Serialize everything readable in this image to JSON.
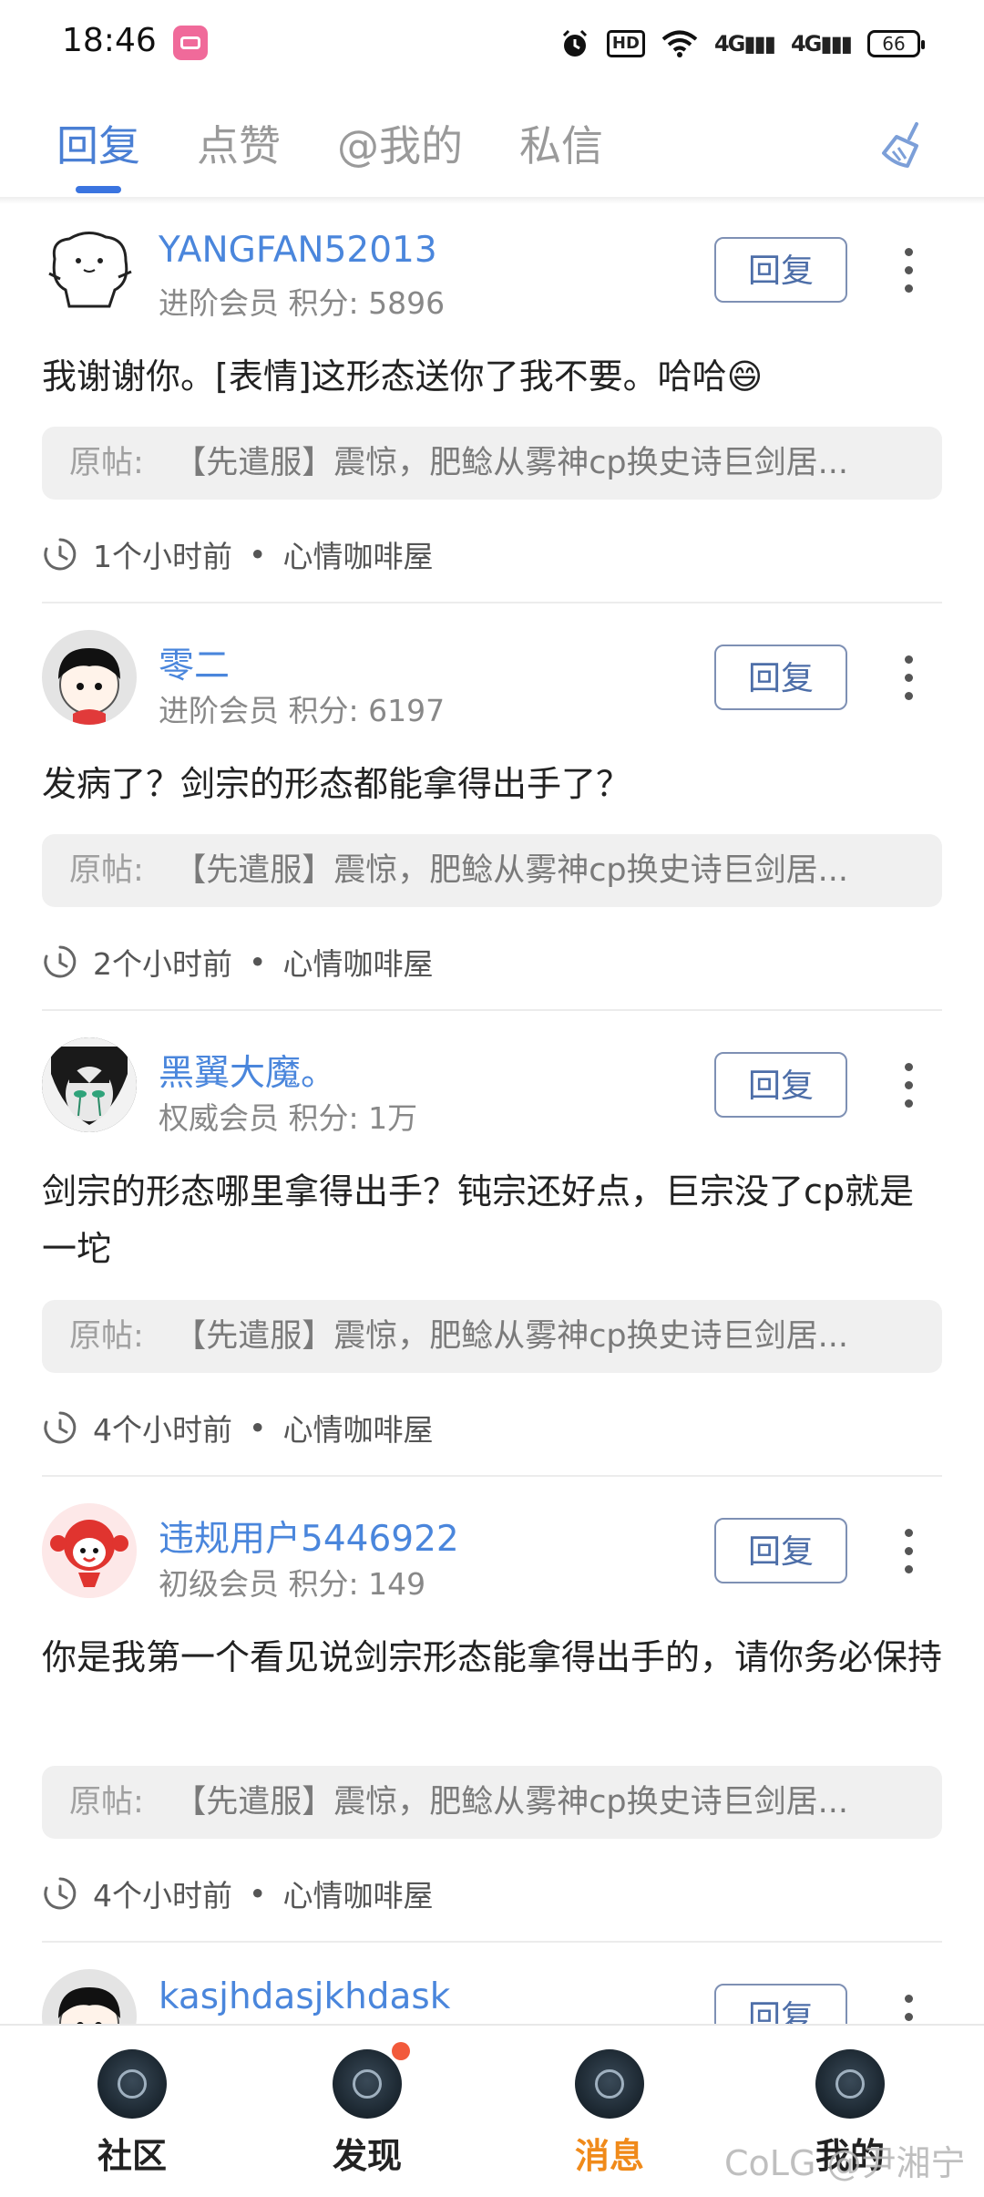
{
  "status_bar": {
    "time": "18:46",
    "network": "4G",
    "hd_label": "HD",
    "battery": "66"
  },
  "tabs": [
    {
      "label": "回复",
      "active": true
    },
    {
      "label": "点赞",
      "active": false
    },
    {
      "label": "@我的",
      "active": false
    },
    {
      "label": "私信",
      "active": false
    }
  ],
  "colors": {
    "accent": "#3a74e0",
    "username": "#4a86dc",
    "active_nav": "#f08a1a",
    "badge": "#f25a3b"
  },
  "clear_icon": "broom-icon",
  "reply_button_label": "回复",
  "messages": [
    {
      "username": "YANGFAN52013",
      "member_level": "进阶会员",
      "points_label": "积分: 5896",
      "content": "我谢谢你。[表情]这形态送你了我不要。哈哈😄",
      "quote_label": "原帖:",
      "quote_text": "【先遣服】震惊，肥鲶从雾神cp换史诗巨剑居...",
      "time_ago": "1个小时前",
      "dot": "•",
      "board": "心情咖啡屋"
    },
    {
      "username": "零二",
      "member_level": "进阶会员",
      "points_label": "积分: 6197",
      "content": "发病了？剑宗的形态都能拿得出手了？",
      "quote_label": "原帖:",
      "quote_text": "【先遣服】震惊，肥鲶从雾神cp换史诗巨剑居...",
      "time_ago": "2个小时前",
      "dot": "•",
      "board": "心情咖啡屋"
    },
    {
      "username": "黑翼大魔。",
      "member_level": "权威会员",
      "points_label": "积分: 1万",
      "content": "剑宗的形态哪里拿得出手？钝宗还好点，巨宗没了cp就是一坨",
      "quote_label": "原帖:",
      "quote_text": "【先遣服】震惊，肥鲶从雾神cp换史诗巨剑居...",
      "time_ago": "4个小时前",
      "dot": "•",
      "board": "心情咖啡屋"
    },
    {
      "username": "违规用户5446922",
      "member_level": "初级会员",
      "points_label": "积分: 149",
      "content": "你是我第一个看见说剑宗形态能拿得出手的，请你务必保持",
      "quote_label": "原帖:",
      "quote_text": "【先遣服】震惊，肥鲶从雾神cp换史诗巨剑居...",
      "time_ago": "4个小时前",
      "dot": "•",
      "board": "心情咖啡屋"
    },
    {
      "username": "kasjhdasjkhdask"
    }
  ],
  "bottom_nav": [
    {
      "label": "社区",
      "icon": "community-icon",
      "active": false
    },
    {
      "label": "发现",
      "icon": "discover-icon",
      "active": false,
      "badge": true
    },
    {
      "label": "消息",
      "icon": "message-icon",
      "active": true
    },
    {
      "label": "我的",
      "icon": "profile-icon",
      "active": false
    }
  ],
  "watermark": "CoLG @尹湘宁"
}
